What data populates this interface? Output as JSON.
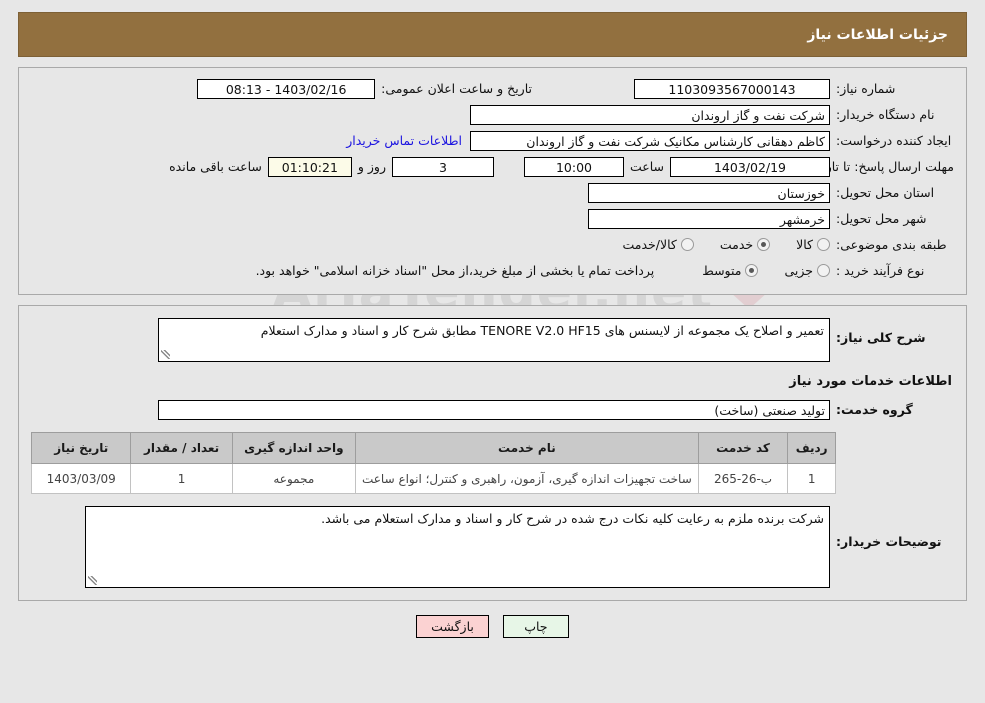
{
  "header": {
    "title": "جزئیات اطلاعات نیاز"
  },
  "labels": {
    "need_number": "شماره نیاز:",
    "buyer_org": "نام دستگاه خریدار:",
    "request_creator": "ایجاد کننده درخواست:",
    "response_deadline": "مهلت ارسال پاسخ: تا تاریخ:",
    "delivery_province": "استان محل تحویل:",
    "delivery_city": "شهر محل تحویل:",
    "subject_category": "طبقه بندی موضوعی:",
    "purchase_process_type": "نوع فرآیند خرید :",
    "public_announce_datetime": "تاریخ و ساعت اعلان عمومی:",
    "hour_label": "ساعت",
    "days_and": "روز و",
    "hours_remaining": "ساعت باقی مانده",
    "buyer_contact_link": "اطلاعات تماس خریدار",
    "general_description": "شرح کلی نیاز:",
    "services_info_title": "اطلاعات خدمات مورد نیاز",
    "service_group": "گروه خدمت:",
    "buyer_notes": "توضیحات خریدار:"
  },
  "values": {
    "need_number": "1103093567000143",
    "buyer_org": "شرکت نفت و گاز اروندان",
    "request_creator": "کاظم دهقانی کارشناس مکانیک شرکت نفت و گاز اروندان",
    "deadline_date": "1403/02/19",
    "deadline_time": "10:00",
    "days_remaining": "3",
    "clock_remaining": "01:10:21",
    "public_announce_datetime": "1403/02/16 - 08:13",
    "delivery_province": "خوزستان",
    "delivery_city": "خرمشهر",
    "general_description": "تعمیر و اصلاح یک مجموعه از لایسنس های TENORE V2.0 HF15 مطابق شرح کار و اسناد و مدارک استعلام",
    "service_group": "تولید صنعتی (ساخت)",
    "buyer_notes": "شرکت برنده ملزم به رعایت کلیه نکات درج شده در شرح کار و اسناد و مدارک استعلام می باشد.",
    "payment_note": "پرداخت تمام یا بخشی از مبلغ خرید،از محل \"اسناد خزانه اسلامی\" خواهد بود."
  },
  "subject_category_options": [
    {
      "label": "کالا",
      "selected": false
    },
    {
      "label": "خدمت",
      "selected": true
    },
    {
      "label": "کالا/خدمت",
      "selected": false
    }
  ],
  "purchase_process_options": [
    {
      "label": "جزیی",
      "selected": false
    },
    {
      "label": "متوسط",
      "selected": true
    }
  ],
  "table": {
    "headers": [
      "ردیف",
      "کد خدمت",
      "نام خدمت",
      "واحد اندازه گیری",
      "تعداد / مقدار",
      "تاریخ نیاز"
    ],
    "rows": [
      {
        "index": "1",
        "code": "ب-26-265",
        "name": "ساخت تجهیزات اندازه گیری، آزمون، راهبری و کنترل؛ انواع ساعت",
        "unit": "مجموعه",
        "qty": "1",
        "need_date": "1403/03/09"
      }
    ]
  },
  "footer": {
    "print_label": "چاپ",
    "back_label": "بازگشت"
  },
  "watermark": {
    "text": "AriaTender.net"
  },
  "colors": {
    "header_bar": "#92703f",
    "link": "#1b13e0",
    "back_button": "#fbd2d2",
    "print_button": "#e7f6e7",
    "table_header": "#c9c9c9",
    "highlight_field": "#fcfbe8"
  }
}
